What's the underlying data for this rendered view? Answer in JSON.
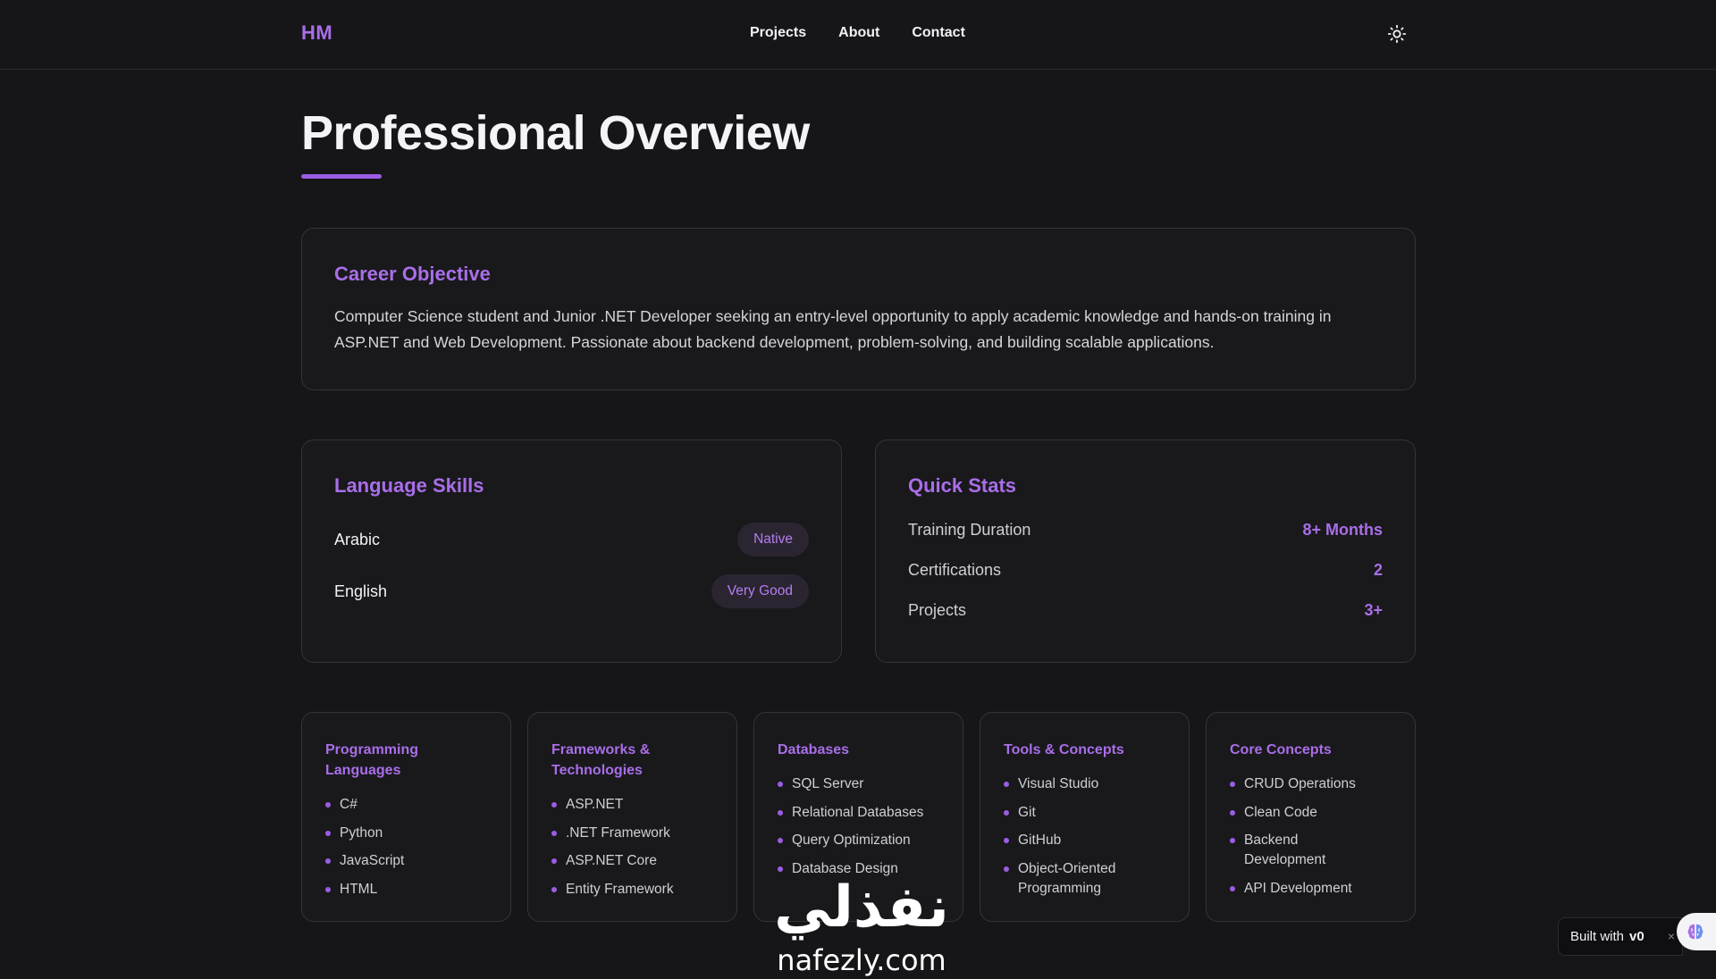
{
  "header": {
    "logo": "HM",
    "nav": [
      "Projects",
      "About",
      "Contact"
    ],
    "theme_toggle_icon": "sun-icon"
  },
  "page": {
    "title": "Professional Overview"
  },
  "career": {
    "title": "Career Objective",
    "text": "Computer Science student and Junior .NET Developer seeking an entry-level opportunity to apply academic knowledge and hands-on training in ASP.NET and Web Development. Passionate about backend development, problem-solving, and building scalable applications."
  },
  "languages": {
    "title": "Language Skills",
    "items": [
      {
        "name": "Arabic",
        "level": "Native"
      },
      {
        "name": "English",
        "level": "Very Good"
      }
    ]
  },
  "stats": {
    "title": "Quick Stats",
    "items": [
      {
        "label": "Training Duration",
        "value": "8+ Months"
      },
      {
        "label": "Certifications",
        "value": "2"
      },
      {
        "label": "Projects",
        "value": "3+"
      }
    ]
  },
  "skills": [
    {
      "title": "Programming Languages",
      "items": [
        "C#",
        "Python",
        "JavaScript",
        "HTML"
      ]
    },
    {
      "title": "Frameworks & Technologies",
      "items": [
        "ASP.NET",
        ".NET Framework",
        "ASP.NET Core",
        "Entity Framework"
      ]
    },
    {
      "title": "Databases",
      "items": [
        "SQL Server",
        "Relational Databases",
        "Query Optimization",
        "Database Design"
      ]
    },
    {
      "title": "Tools & Concepts",
      "items": [
        "Visual Studio",
        "Git",
        "GitHub",
        "Object-Oriented Programming"
      ]
    },
    {
      "title": "Core Concepts",
      "items": [
        "CRUD Operations",
        "Clean Code",
        "Backend Development",
        "API Development"
      ]
    }
  ],
  "watermark": {
    "arabic": "نفذلي",
    "latin": "nafezly.com"
  },
  "built_with": {
    "label": "Built with",
    "brand": "v0",
    "close": "×"
  },
  "colors": {
    "accent": "#a96ee8",
    "background": "#161618",
    "card": "#19191c",
    "border": "#34343a"
  }
}
